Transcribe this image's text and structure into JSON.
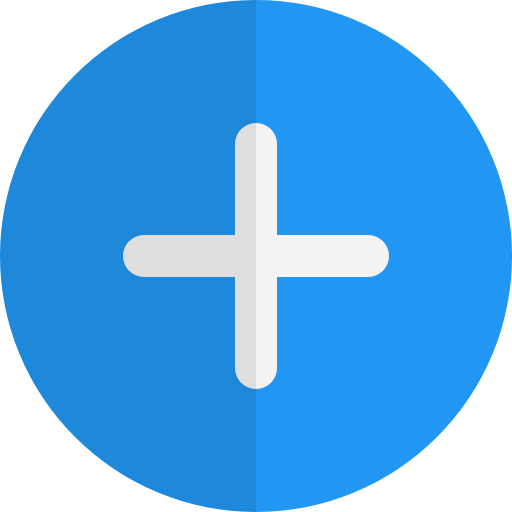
{
  "icon": {
    "name": "add-circle-icon",
    "colors": {
      "circle_left": "#1E88DB",
      "circle_right": "#2196F3",
      "plus_left": "#DEDEDE",
      "plus_right": "#F3F3F3"
    }
  }
}
